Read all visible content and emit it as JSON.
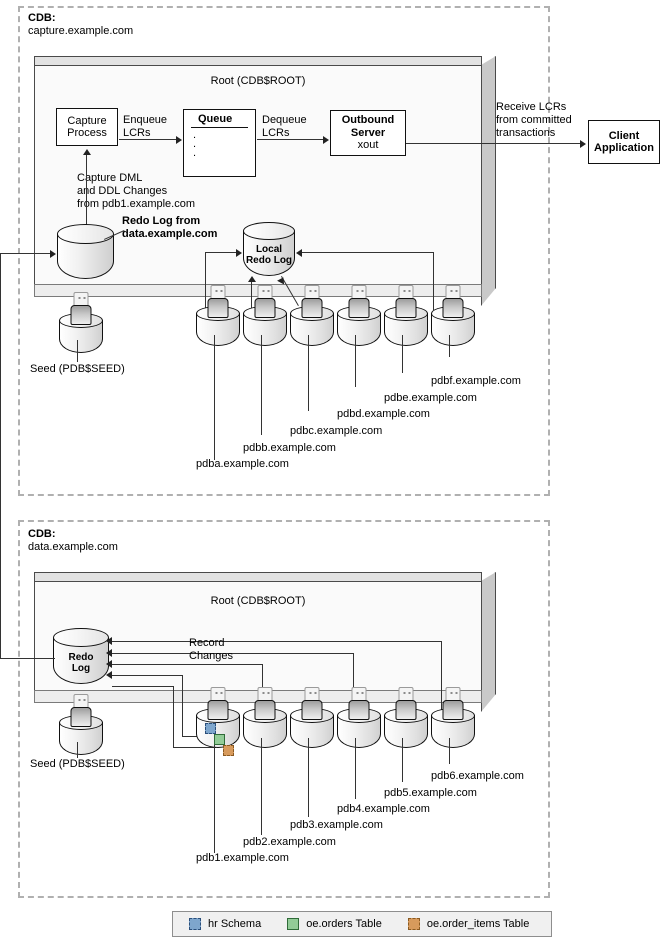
{
  "capture_cdb": {
    "title": "CDB:",
    "name": "capture.example.com",
    "root_title": "Root (CDB$ROOT)",
    "capture_process": {
      "line1": "Capture",
      "line2": "Process"
    },
    "enqueue_label": {
      "line1": "Enqueue",
      "line2": "LCRs"
    },
    "queue": {
      "title": "Queue",
      "dot1": ".",
      "dot2": ".",
      "dot3": "."
    },
    "dequeue_label": {
      "line1": "Dequeue",
      "line2": "LCRs"
    },
    "outbound_server": {
      "line1": "Outbound",
      "line2": "Server",
      "line3": "xout"
    },
    "capture_changes_label": {
      "line1": "Capture DML",
      "line2": "and DDL Changes",
      "line3": "from pdb1.example.com"
    },
    "redo_log_label": {
      "line1": "Redo Log from",
      "line2": "data.example.com"
    },
    "local_redo_log": {
      "line1": "Local",
      "line2": "Redo Log"
    },
    "seed_label": "Seed (PDB$SEED)",
    "pdbs": [
      "pdba.example.com",
      "pdbb.example.com",
      "pdbc.example.com",
      "pdbd.example.com",
      "pdbe.example.com",
      "pdbf.example.com"
    ]
  },
  "client": {
    "receive_label": {
      "line1": "Receive LCRs",
      "line2": "from committed",
      "line3": "transactions"
    },
    "box": {
      "line1": "Client",
      "line2": "Application"
    }
  },
  "data_cdb": {
    "title": "CDB:",
    "name": "data.example.com",
    "root_title": "Root (CDB$ROOT)",
    "redo_log": {
      "line1": "Redo",
      "line2": "Log"
    },
    "record_changes_label": {
      "line1": "Record",
      "line2": "Changes"
    },
    "seed_label": "Seed (PDB$SEED)",
    "pdbs": [
      "pdb1.example.com",
      "pdb2.example.com",
      "pdb3.example.com",
      "pdb4.example.com",
      "pdb5.example.com",
      "pdb6.example.com"
    ]
  },
  "legend": {
    "items": [
      {
        "label": "hr Schema",
        "color": "#7ea6cd"
      },
      {
        "label": "oe.orders Table",
        "color": "#92cc97"
      },
      {
        "label": "oe.order_items Table",
        "color": "#d79a5c"
      }
    ]
  }
}
